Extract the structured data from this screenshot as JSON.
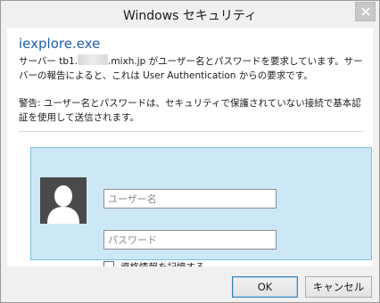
{
  "window": {
    "title": "Windows セキュリティ"
  },
  "header": {
    "app_name": "iexplore.exe",
    "message1_prefix": "サーバー tb1.",
    "message1_rest": ".mixh.jp がユーザー名とパスワードを要求しています。サーバーの報告によると、これは User Authentication からの要求です。",
    "warning": "警告: ユーザー名とパスワードは、セキュリティで保護されていない接続で基本認証を使用して送信されます。"
  },
  "credentials": {
    "avatar_icon": "user-avatar-icon",
    "username_placeholder": "ユーザー名",
    "username_value": "",
    "password_placeholder": "パスワード",
    "password_value": "",
    "remember_label": "資格情報を記憶する",
    "remember_checked": false
  },
  "footer": {
    "ok_label": "OK",
    "cancel_label": "キャンセル"
  },
  "colors": {
    "tile_bg": "#cce8f7",
    "tile_border": "#7fbde0",
    "app_name": "#1e5fae"
  }
}
